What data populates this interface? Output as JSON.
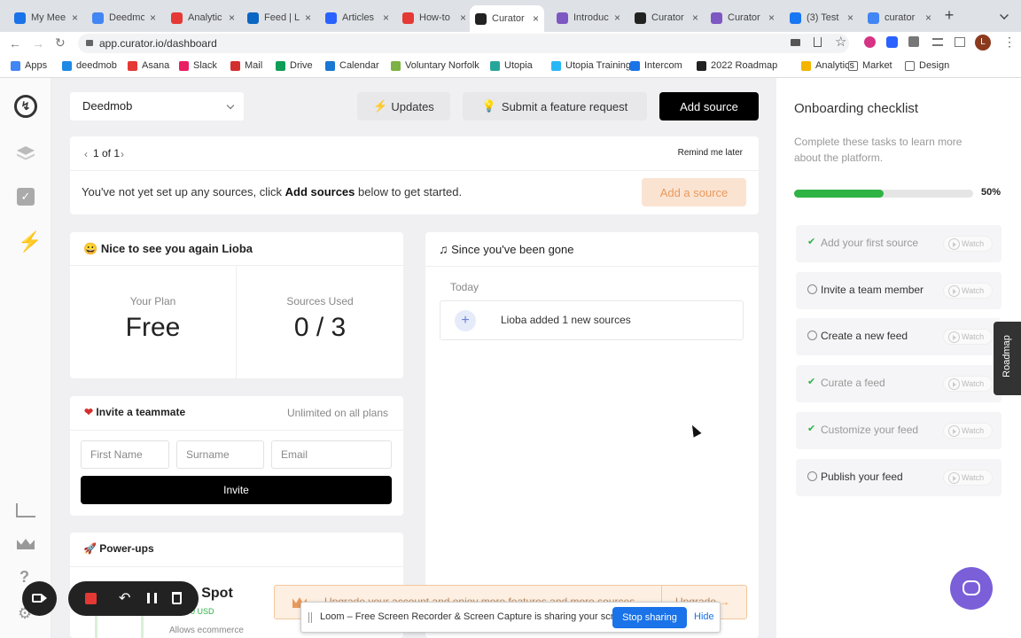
{
  "browser": {
    "tabs": [
      {
        "title": "My Mee",
        "color": "#1a73e8"
      },
      {
        "title": "Deedmo",
        "color": "#4285f4"
      },
      {
        "title": "Analytic",
        "color": "#e53935"
      },
      {
        "title": "Feed | L",
        "color": "#0a66c2"
      },
      {
        "title": "Articles",
        "color": "#2962ff"
      },
      {
        "title": "How-to",
        "color": "#e53935"
      },
      {
        "title": "Curator",
        "color": "#222222",
        "active": true
      },
      {
        "title": "Introduc",
        "color": "#7e57c2"
      },
      {
        "title": "Curator",
        "color": "#222222"
      },
      {
        "title": "Curator",
        "color": "#7e57c2"
      },
      {
        "title": "(3) Test",
        "color": "#1877f2"
      },
      {
        "title": "curator",
        "color": "#4285f4"
      }
    ],
    "url": "app.curator.io/dashboard",
    "bookmarks": [
      "Apps",
      "deedmob",
      "Asana",
      "Slack",
      "Mail",
      "Drive",
      "Calendar",
      "Voluntary Norfolk",
      "Utopia",
      "Utopia Training",
      "Intercom",
      "2022 Roadmap",
      "Analytics",
      "Market",
      "Design"
    ],
    "profile_initial": "L"
  },
  "header": {
    "org_select": "Deedmob",
    "updates_label": "Updates",
    "feature_request_label": "Submit a feature request",
    "add_source_label": "Add source"
  },
  "notice": {
    "pager": "1 of 1",
    "remind_label": "Remind me later",
    "message_pre": "You've not yet set up any sources, click ",
    "message_bold": "Add sources",
    "message_post": " below to get started.",
    "add_a_source_label": "Add a source"
  },
  "welcome": {
    "title": "Nice to see you again Lioba",
    "plan_label": "Your Plan",
    "plan_value": "Free",
    "sources_label": "Sources Used",
    "sources_value": "0 / 3"
  },
  "since_gone": {
    "title": "Since you've been gone",
    "day_label": "Today",
    "activity_text": "Lioba added 1 new sources"
  },
  "invite": {
    "title": "Invite a teammate",
    "subtitle": "Unlimited on all plans",
    "first_name_placeholder": "First Name",
    "surname_placeholder": "Surname",
    "email_placeholder": "Email",
    "invite_button": "Invite"
  },
  "powerups": {
    "title": "Power-ups",
    "item_name": "p Spot",
    "item_price": "0 USD",
    "item_desc": "Allows ecommerce"
  },
  "upgrade_banner": {
    "text": "Upgrade your account and enjoy more features and more sources",
    "button": "Upgrade"
  },
  "onboarding": {
    "title": "Onboarding checklist",
    "description": "Complete these tasks to learn more about the platform.",
    "progress_percent": 50,
    "progress_label": "50%",
    "watch_label": "Watch",
    "items": [
      {
        "label": "Add your first source",
        "done": true
      },
      {
        "label": "Invite a team member",
        "done": false
      },
      {
        "label": "Create a new feed",
        "done": false
      },
      {
        "label": "Curate a feed",
        "done": true
      },
      {
        "label": "Customize your feed",
        "done": true
      },
      {
        "label": "Publish your feed",
        "done": false
      }
    ]
  },
  "roadmap_tab": "Roadmap",
  "loom": {
    "share_text": "Loom – Free Screen Recorder & Screen Capture is sharing your screen.",
    "stop_label": "Stop sharing",
    "hide_label": "Hide"
  },
  "colors": {
    "accent_green": "#2fb344",
    "add_source_bg": "#000000",
    "add_a_source_bg": "#fbe3d2",
    "add_a_source_text": "#e89a5d",
    "chat_bubble": "#7a5fd8",
    "loom_stop": "#1a73e8"
  }
}
